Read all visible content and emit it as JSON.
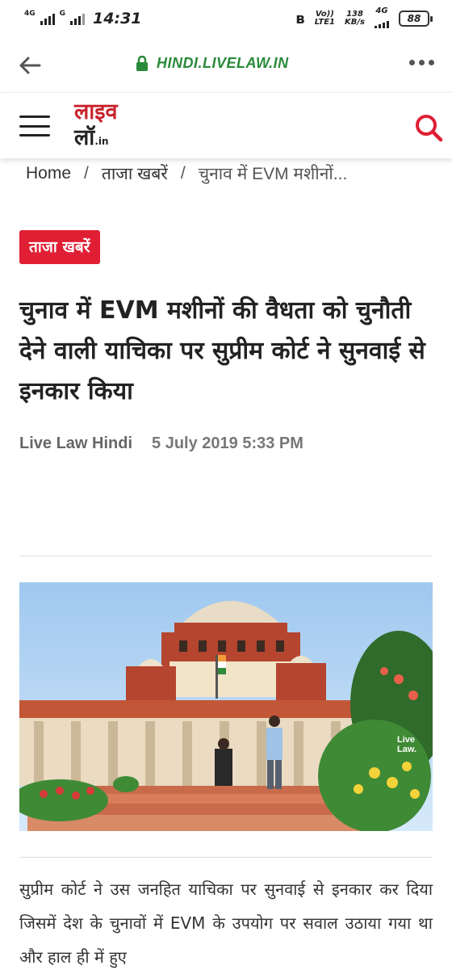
{
  "status_bar": {
    "net1": "4G",
    "net2": "G",
    "time": "14:31",
    "volte": "Vo))",
    "lte": "LTE1",
    "speed_value": "138",
    "speed_unit": "KB/s",
    "net3": "4G",
    "battery": "88"
  },
  "browser": {
    "url": "HINDI.LIVELAW.IN"
  },
  "site": {
    "logo_line1": "लाइव",
    "logo_line2": "लॉ",
    "logo_suffix": ".in"
  },
  "breadcrumb": {
    "home": "Home",
    "sep": "/",
    "category": "ताजा खबरें",
    "current": "चुनाव में EVM मशीनों..."
  },
  "article": {
    "badge": "ताजा खबरें",
    "title": "चुनाव में EVM मशीनों की वैधता को चुनौती देने वाली याचिका पर सुप्रीम कोर्ट ने सुनवाई से इनकार किया",
    "author": "Live Law Hindi",
    "date": "5 July 2019 5:33 PM",
    "image_watermark_1": "Live",
    "image_watermark_2": "Law.",
    "body": "सुप्रीम कोर्ट ने उस जनहित याचिका पर सुनवाई से इनकार कर दिया जिसमें देश के चुनावों में EVM के उपयोग पर सवाल उठाया गया था और हाल ही में हुए"
  },
  "colors": {
    "brand_red": "#e01e34",
    "secure_green": "#2a8a3a"
  },
  "icons": {
    "back": "arrow-left-icon",
    "lock": "lock-icon",
    "menu": "more-dots-icon",
    "hamburger": "hamburger-icon",
    "search": "search-icon"
  }
}
